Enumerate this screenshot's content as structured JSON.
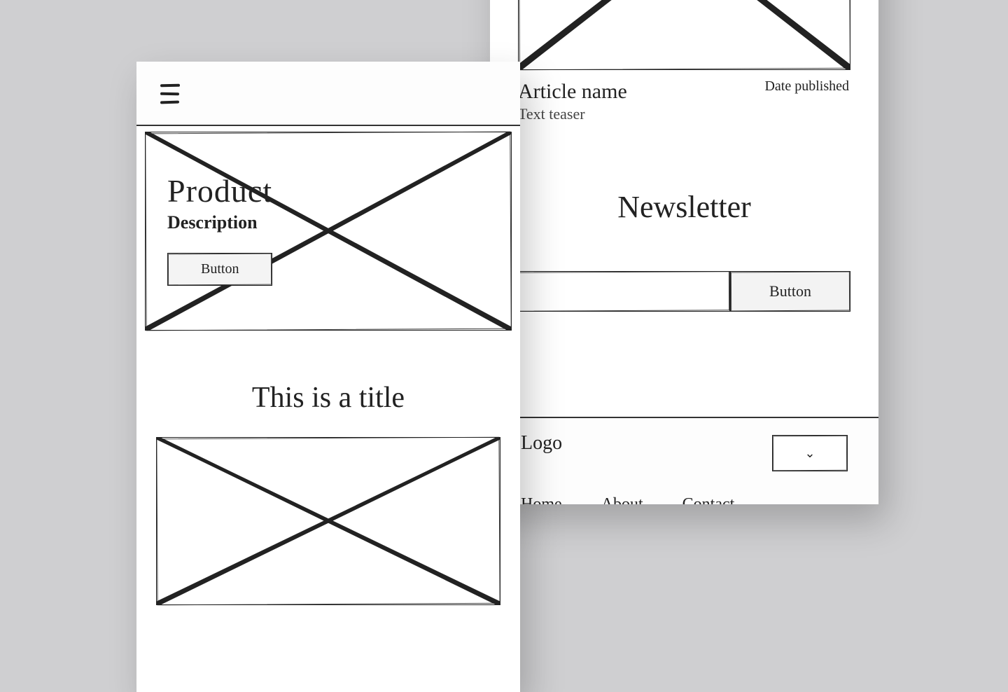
{
  "left": {
    "hero": {
      "title": "Product",
      "subtitle": "Description",
      "button": "Button"
    },
    "section_title": "This is a title"
  },
  "right": {
    "article": {
      "name": "Article name",
      "date": "Date published",
      "teaser": "Text teaser"
    },
    "newsletter": {
      "title": "Newsletter",
      "button": "Button"
    },
    "footer": {
      "logo": "Logo",
      "links": {
        "home": "Home",
        "about": "About",
        "contact": "Contact"
      }
    }
  }
}
